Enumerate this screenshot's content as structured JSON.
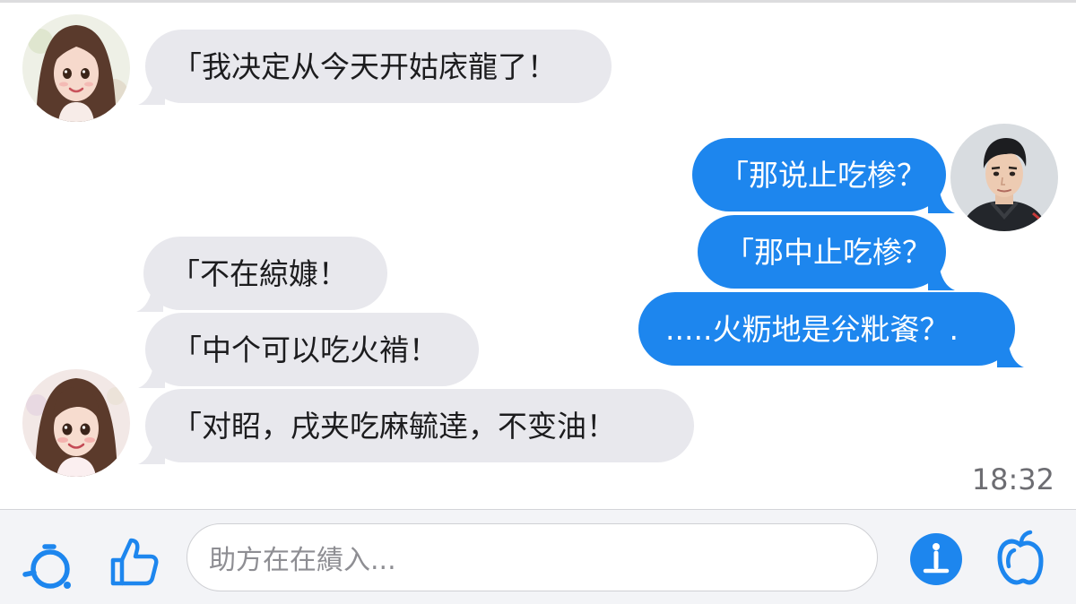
{
  "messages": [
    {
      "side": "in",
      "text": "「我决定从今天开姑庡龍了！"
    },
    {
      "side": "out",
      "text": "「那说止吃椮？"
    },
    {
      "side": "out",
      "text": "「那中止吃椮？"
    },
    {
      "side": "in",
      "text": "「不在綡嫝！"
    },
    {
      "side": "out",
      "text": ".....火粝地是兊粃餈？."
    },
    {
      "side": "in",
      "text": "「中个可以吃火褃！"
    },
    {
      "side": "in",
      "text": "「对眧，戌夹吃麻毓逹，不变油！"
    }
  ],
  "timestamp": "18:32",
  "composer": {
    "placeholder": "助方在在績入..."
  },
  "icons": {
    "left_1": "emoji-ring-icon",
    "left_2": "thumbs-up-icon",
    "right_1": "info-icon",
    "right_2": "apple-icon"
  },
  "colors": {
    "outgoing_bubble": "#1d86ee",
    "incoming_bubble": "#e8e8ed",
    "accent": "#1d86ee"
  }
}
